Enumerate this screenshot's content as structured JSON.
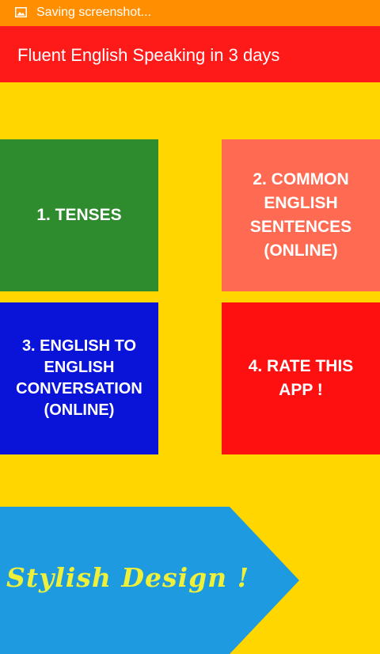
{
  "status_bar": {
    "text": "Saving screenshot...",
    "icon": "image-icon",
    "color": "#FF8F00"
  },
  "app_bar": {
    "title": "Fluent English Speaking in 3 days",
    "color": "#FF1A1A"
  },
  "background_color": "#FFD600",
  "menu": {
    "items": [
      {
        "label": "1. TENSES",
        "color": "#2E8B2E"
      },
      {
        "label": "2. COMMON ENGLISH SENTENCES (ONLINE)",
        "color": "#FF6B52"
      },
      {
        "label": "3. ENGLISH TO ENGLISH CONVERSATION (ONLINE)",
        "color": "#0A14D8"
      },
      {
        "label": "4. RATE THIS APP !",
        "color": "#FF1010"
      }
    ]
  },
  "banner": {
    "text": "Stylish Design !",
    "color": "#1E9BE0",
    "text_color": "#EEF03A"
  }
}
